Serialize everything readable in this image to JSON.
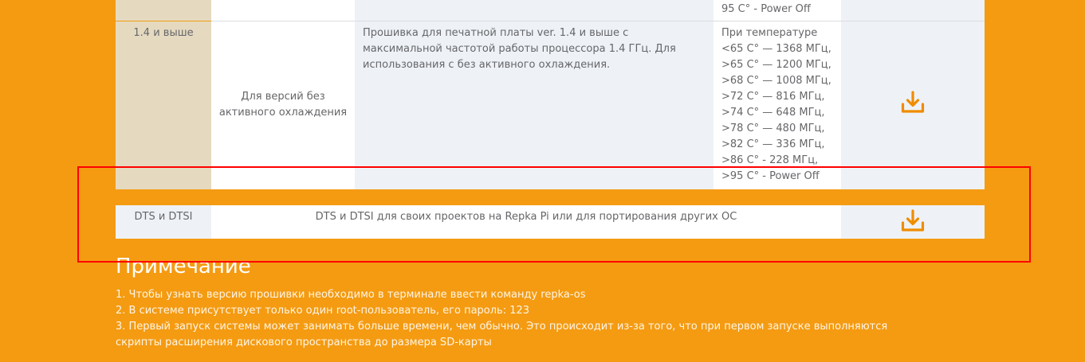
{
  "table": {
    "row_top": {
      "spec_tail": "95 C° - Power Off"
    },
    "row_main": {
      "version": "1.4 и выше",
      "cooling": "Для версий без активного охлаждения",
      "description": "Прошивка для печатной платы ver. 1.4 и выше с максимальной частотой работы процессора 1.4 ГГц. Для использования с без активного охлаждения.",
      "spec_lines": [
        "При температуре",
        "<65 C° — 1368 МГц,",
        ">65 C° — 1200 МГц,",
        ">68 C° — 1008 МГц,",
        ">72 C° — 816 МГц,",
        ">74 C° — 648 МГц,",
        ">78 C° — 480 МГц,",
        ">82 C° — 336 МГц,",
        ">86 C° - 228 МГц,",
        ">95 C° - Power Off"
      ],
      "download_icon": "download-icon"
    },
    "row_dts": {
      "name": "DTS и DTSI",
      "description": "DTS и DTSI для своих проектов на Repka Pi или для портирования других ОС",
      "download_icon": "download-icon"
    }
  },
  "notes": {
    "title": "Примечание",
    "items": [
      "1. Чтобы узнать версию прошивки необходимо в терминале ввести команду repka-os",
      "2. В системе присутствует только один root-пользователь, его пароль: 123",
      "3. Первый запуск системы может занимать больше времени, чем обычно. Это происходит из-за того, что при первом запуске выполняются скрипты расширения дискового пространства до размера SD-карты"
    ]
  },
  "colors": {
    "page_bg": "#f49b12",
    "version_col_bg": "#e5dac0",
    "light_col_bg": "#eef2f6",
    "white_col_bg": "#ffffff",
    "icon_orange": "#f08c00",
    "highlight_red": "#ff0000"
  }
}
